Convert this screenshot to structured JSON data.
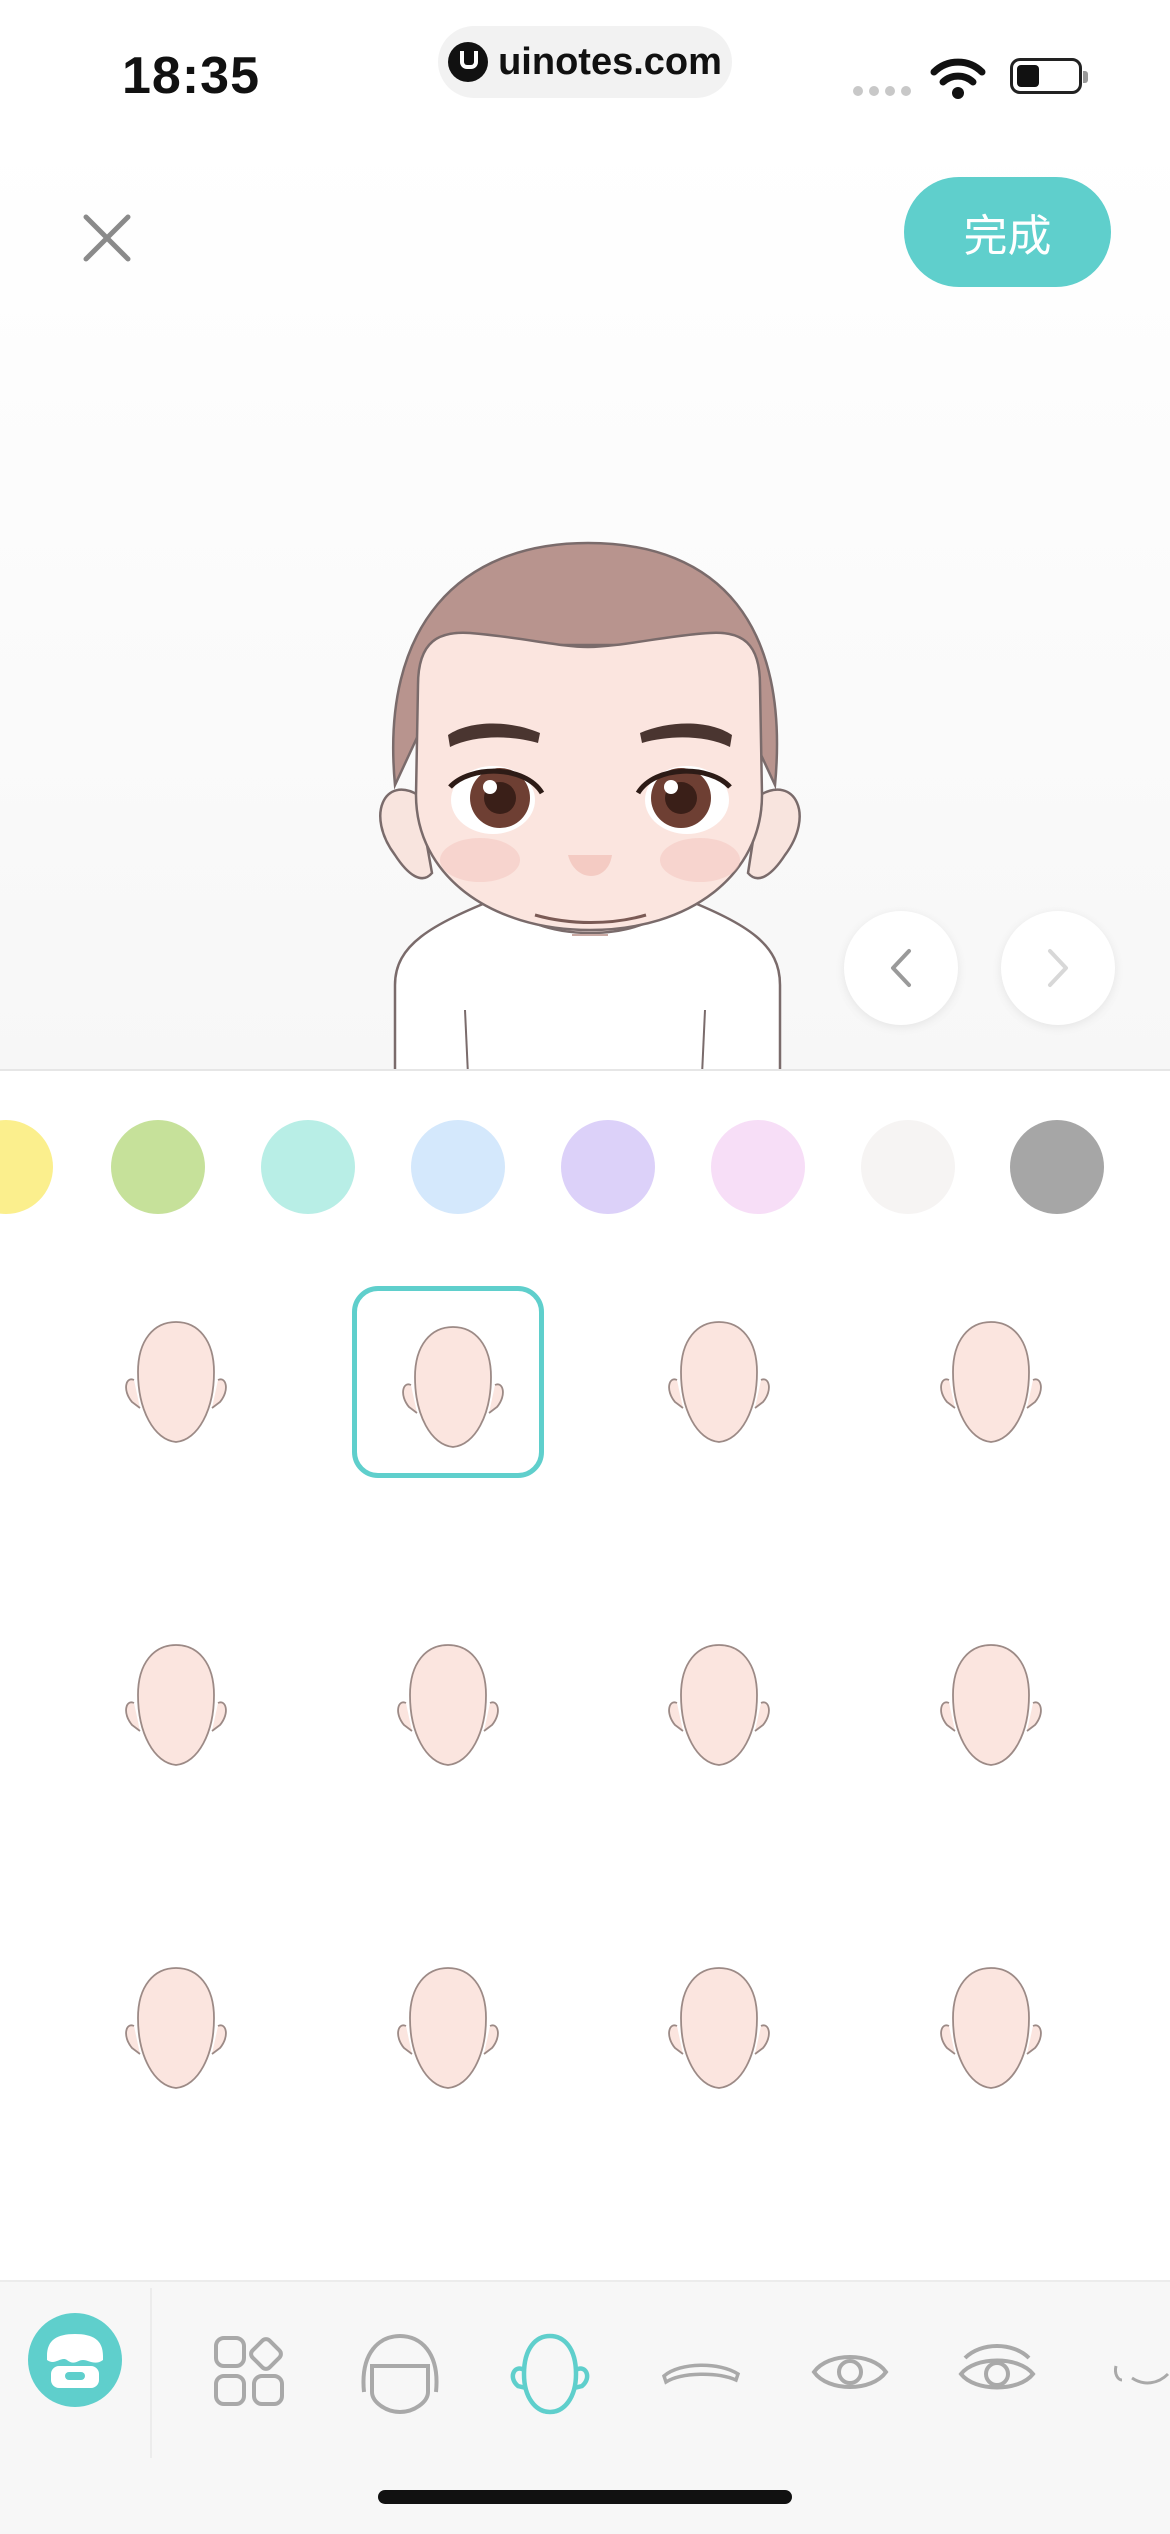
{
  "status_bar": {
    "time": "18:35",
    "url": "uinotes.com"
  },
  "header": {
    "done_label": "完成"
  },
  "colors": {
    "accent": "#5fcfcc",
    "swatches": [
      "#fbef8d",
      "#c6e19a",
      "#b8eee6",
      "#d4e8fc",
      "#dcd1f9",
      "#f7def7",
      "#f6f4f3",
      "#a6a6a6"
    ]
  },
  "face_grid": {
    "selected_index": 1,
    "count": 12
  },
  "toolbar": {
    "items": [
      "avatar-store-icon",
      "categories-icon",
      "hair-icon",
      "face-shape-icon",
      "eyebrow-icon",
      "eye-icon",
      "eye-detail-icon",
      "mouth-icon"
    ],
    "active": "face-shape-icon"
  }
}
